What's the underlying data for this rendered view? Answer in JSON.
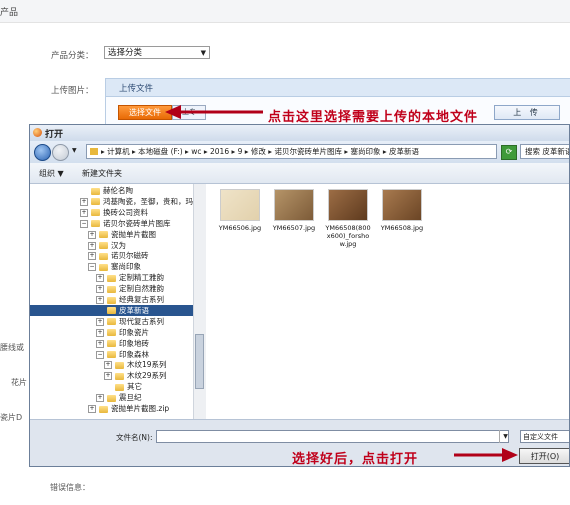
{
  "page": {
    "header_fragment": "产品",
    "category_label": "产品分类：",
    "category_select": "选择分类",
    "upload_label": "上传图片：",
    "upload_panel_title": "上传文件",
    "select_file_button": "选择文件",
    "side_button_fragment": "上专",
    "upload_button": "上 传",
    "side_labels": [
      "腰线或",
      "花片",
      "瓷片D"
    ],
    "error_label": "错误信息："
  },
  "annotations": {
    "top": "点击这里选择需要上传的本地文件",
    "bottom": "选择好后，点击打开"
  },
  "dialog": {
    "title": "打开",
    "breadcrumb": "▸ 计算机 ▸ 本地磁盘 (F:) ▸ wc ▸ 2016 ▸ 9 ▸ 修改 ▸ 诺贝尔瓷砖单片图库 ▸ 塞尚印象 ▸ 皮革新语",
    "search_placeholder": "搜索 皮革新语",
    "toolbar": {
      "organize": "组织 ▼",
      "new_folder": "新建文件夹"
    },
    "tree": [
      {
        "label": "赫伦名陶",
        "pm": "",
        "level": 1
      },
      {
        "label": "鸿基陶瓷，圣御，贵和，玛",
        "pm": "+",
        "level": 1
      },
      {
        "label": "换砖公司资料",
        "pm": "+",
        "level": 1
      },
      {
        "label": "诺贝尔瓷砖单片图库",
        "pm": "−",
        "level": 1
      },
      {
        "label": "瓷抛单片截图",
        "pm": "+",
        "level": 2
      },
      {
        "label": "汉为",
        "pm": "+",
        "level": 2
      },
      {
        "label": "诺贝尔磁砖",
        "pm": "+",
        "level": 2
      },
      {
        "label": "塞尚印象",
        "pm": "−",
        "level": 2
      },
      {
        "label": "定制精工雅韵",
        "pm": "+",
        "level": 3
      },
      {
        "label": "定制自然雅韵",
        "pm": "+",
        "level": 3
      },
      {
        "label": "经典复古系列",
        "pm": "+",
        "level": 3
      },
      {
        "label": "皮革新语",
        "pm": "",
        "level": 3,
        "selected": true
      },
      {
        "label": "现代复古系列",
        "pm": "+",
        "level": 3
      },
      {
        "label": "印象瓷片",
        "pm": "+",
        "level": 3
      },
      {
        "label": "印象地砖",
        "pm": "+",
        "level": 3
      },
      {
        "label": "印象森林",
        "pm": "−",
        "level": 3
      },
      {
        "label": "木纹19系列",
        "pm": "+",
        "level": 4
      },
      {
        "label": "木纹29系列",
        "pm": "+",
        "level": 4
      },
      {
        "label": "其它",
        "pm": "",
        "level": 4
      },
      {
        "label": "震旦纪",
        "pm": "+",
        "level": 3
      },
      {
        "label": "瓷抛单片截图.zip",
        "pm": "+",
        "level": 2
      }
    ],
    "files": [
      {
        "name": "YM66506.jpg",
        "color1": "#efe3c8",
        "color2": "#e2d1ac"
      },
      {
        "name": "YM66507.jpg",
        "color1": "#b59468",
        "color2": "#7d5b38"
      },
      {
        "name": "YM66508(800x600)_forshow.jpg",
        "color1": "#9c6d45",
        "color2": "#5e3a1e"
      },
      {
        "name": "YM66508.jpg",
        "color1": "#a87a4f",
        "color2": "#6b4525"
      }
    ],
    "filename_label": "文件名(N):",
    "filetype": "自定义文件",
    "open_button": "打开(O)"
  }
}
